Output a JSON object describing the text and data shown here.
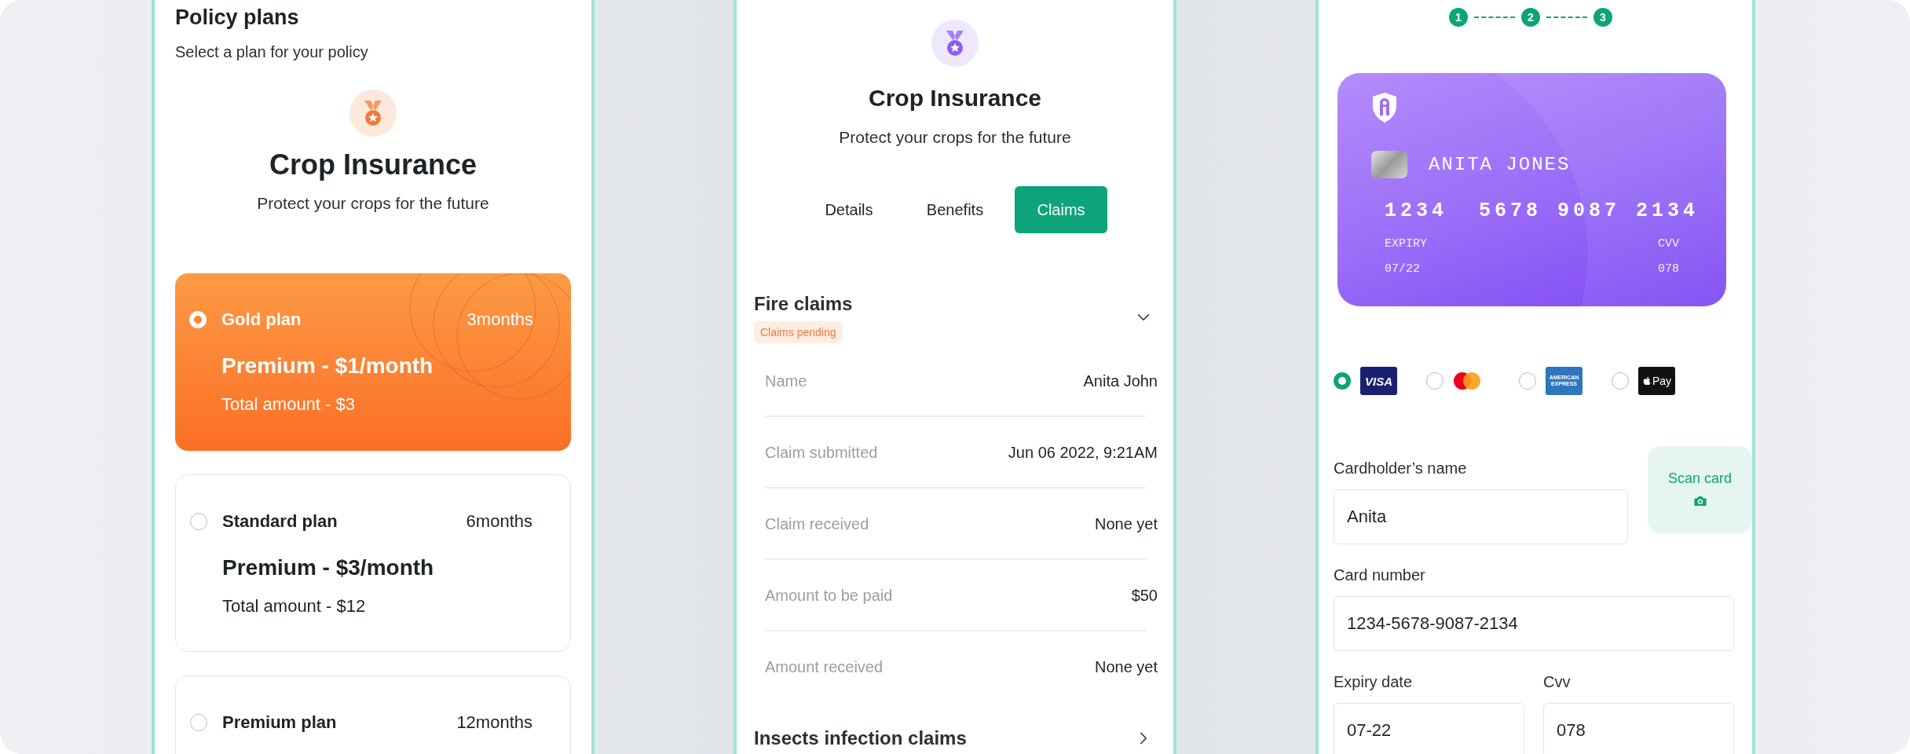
{
  "plans_screen": {
    "title": "Policy plans",
    "subtitle": "Select a plan for your policy",
    "product": {
      "title": "Crop Insurance",
      "subtitle": "Protect your crops for the future"
    },
    "plans": [
      {
        "name": "Gold plan",
        "duration": "3months",
        "premium": "Premium - $1/month",
        "total": "Total amount - $3",
        "selected": true
      },
      {
        "name": "Standard plan",
        "duration": "6months",
        "premium": "Premium - $3/month",
        "total": "Total amount - $12",
        "selected": false
      },
      {
        "name": "Premium plan",
        "duration": "12months",
        "selected": false
      }
    ]
  },
  "claims_screen": {
    "product": {
      "title": "Crop Insurance",
      "subtitle": "Protect your crops for the future"
    },
    "tabs": [
      {
        "label": "Details",
        "selected": false
      },
      {
        "label": "Benefits",
        "selected": false
      },
      {
        "label": "Claims",
        "selected": true
      }
    ],
    "claim_groups": [
      {
        "title": "Fire claims",
        "badge": "Claims pending",
        "expanded": true,
        "rows": [
          {
            "label": "Name",
            "value": "Anita John"
          },
          {
            "label": "Claim submitted",
            "value": "Jun 06 2022, 9:21AM"
          },
          {
            "label": "Claim received",
            "value": "None yet"
          },
          {
            "label": "Amount to be paid",
            "value": "$50"
          },
          {
            "label": "Amount received",
            "value": "None yet"
          }
        ]
      },
      {
        "title": "Insects infection claims",
        "expanded": false
      }
    ]
  },
  "payment_screen": {
    "steps": [
      "1",
      "2",
      "3"
    ],
    "card": {
      "holder": "ANITA JONES",
      "number": "1234  5678 9087 2134",
      "expiry_label": "EXPIRY",
      "expiry": "07/22",
      "cvv_label": "CVV",
      "cvv": "078"
    },
    "methods": [
      {
        "kind": "visa",
        "label": "VISA",
        "selected": true
      },
      {
        "kind": "mastercard",
        "selected": false
      },
      {
        "kind": "amex",
        "label": "AMERICAN EXPRESS",
        "selected": false
      },
      {
        "kind": "applepay",
        "label": "Pay",
        "selected": false
      }
    ],
    "cardholder": {
      "label": "Cardholder’s name",
      "value": "Anita"
    },
    "scan_button": "Scan card",
    "card_number": {
      "label": "Card number",
      "value": "1234-5678-9087-2134"
    },
    "expiry": {
      "label": "Expiry date",
      "value": "07-22"
    },
    "cvv": {
      "label": "Cvv",
      "value": "078"
    }
  }
}
